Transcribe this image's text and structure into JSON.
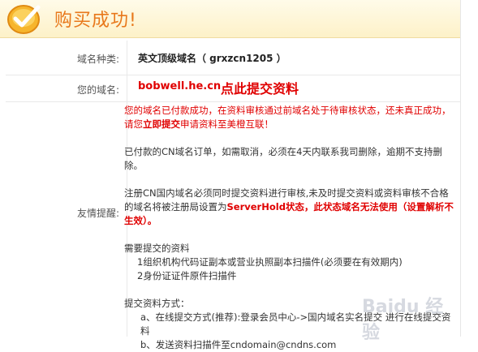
{
  "header": {
    "title": "购买成功!",
    "icon": "check-circle-icon"
  },
  "domain_type": {
    "label": "域名种类:",
    "value": "英文顶级域名（ grxzcn1205 ）"
  },
  "your_domain": {
    "label": "您的域名:",
    "domain": "bobwell.he.cn",
    "submit_link": "点此提交资料"
  },
  "notes": {
    "label": "友情提醒:",
    "p1_a": "您的域名已付款成功，在资料审核通过前域名处于待审核状态，还未真正成功，请您",
    "p1_b": "立即提交",
    "p1_c": "申请资料至美橙互联！",
    "p2": "已付款的CN域名订单，如需取消，必须在4天内联系我司删除，逾期不支持删除。",
    "p3_a": "注册CN国内域名必须同时提交资料进行审核,未及时提交资料或资料审核不合格的域名将被注册局设置为",
    "p3_b": "ServerHold状态",
    "p3_c": "，此状态域名无法使用（设置解析不生效）。",
    "docs_title": "需要提交的资料",
    "doc1": "1组织机构代码证副本或营业执照副本扫描件(必须要在有效期内)",
    "doc2": "2身份证证件原件扫描件",
    "methods_title": "提交资料方式：",
    "method_a": "a、在线提交方式(推荐):登录会员中心->国内域名实名提交 进行在线提交资料",
    "method_b": "b、发送资料扫描件至cndomain@cndns.com"
  },
  "watermark": "Baidu 经验"
}
